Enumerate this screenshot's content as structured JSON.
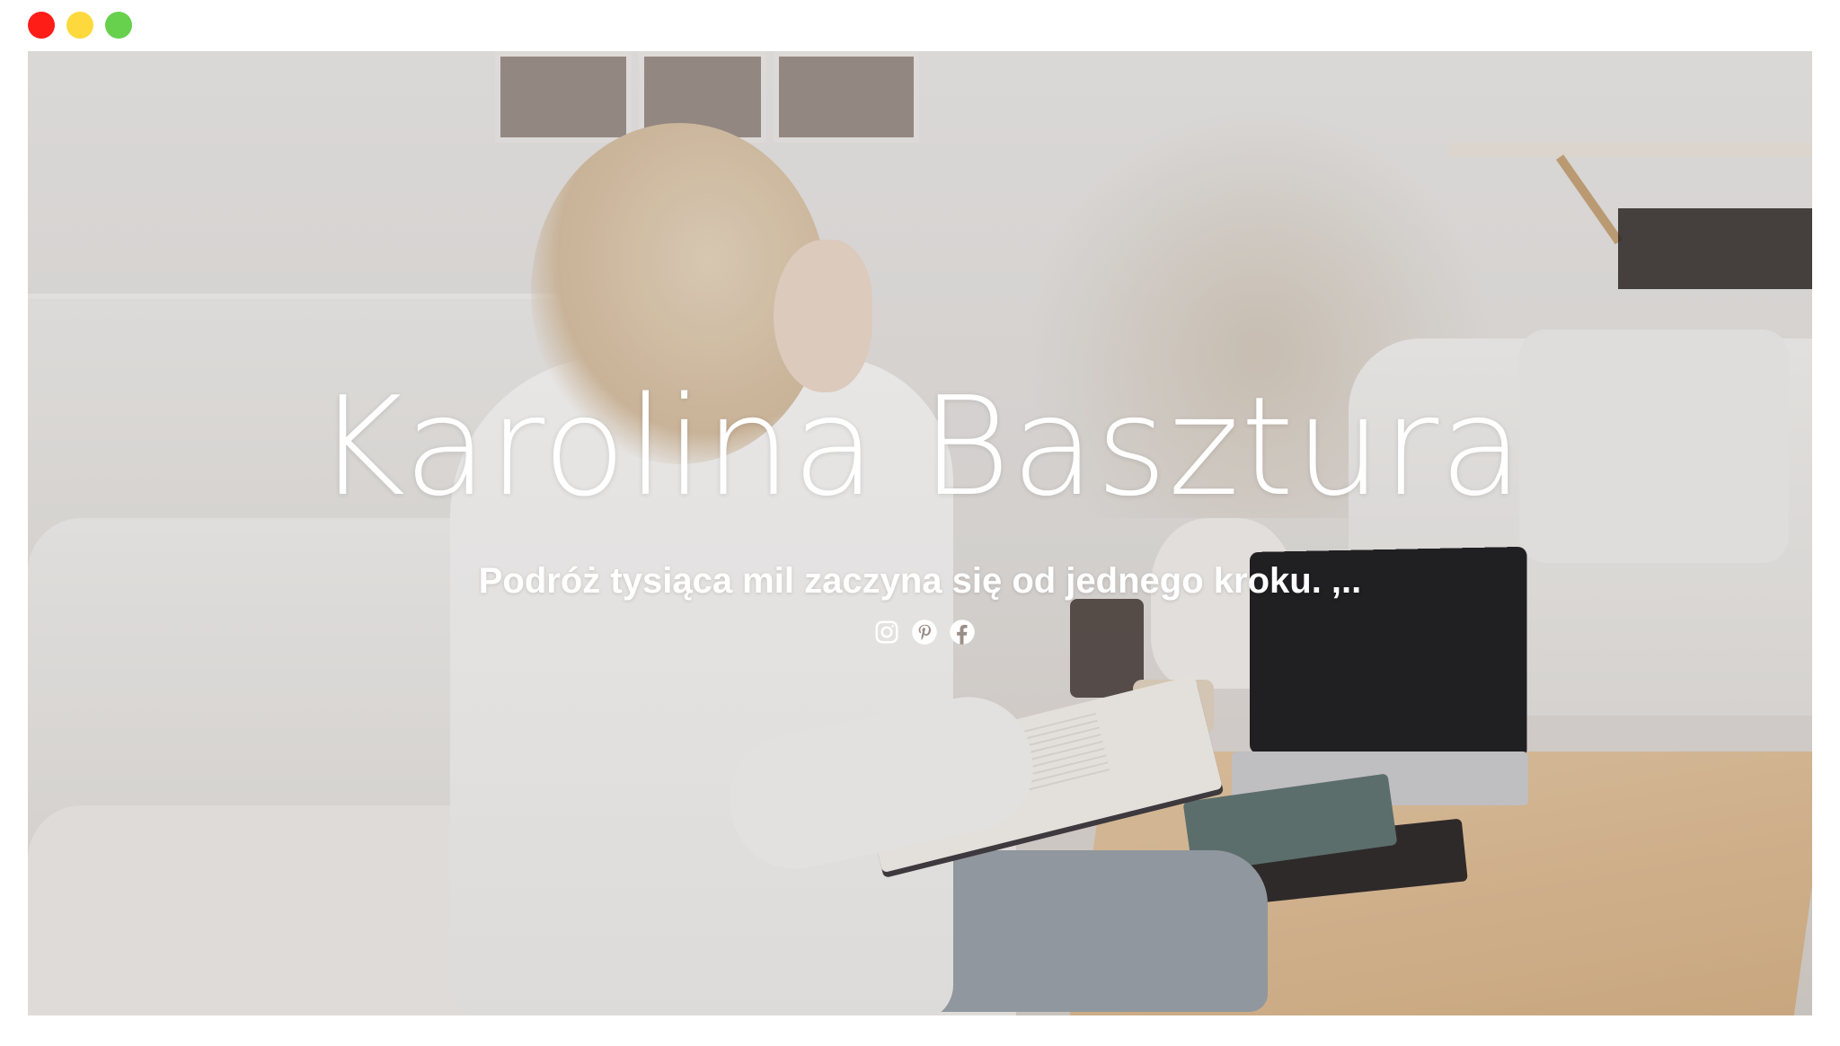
{
  "window": {
    "controls": [
      "close",
      "minimize",
      "maximize"
    ],
    "colors": {
      "close": "#fe1d17",
      "minimize": "#fed93d",
      "maximize": "#67d04d"
    }
  },
  "hero": {
    "title": "Karolina Basztura",
    "tagline": "Podróż tysiąca mil zaczyna się od jednego kroku. ,..",
    "social_links": [
      {
        "icon": "instagram-icon"
      },
      {
        "icon": "pinterest-icon"
      },
      {
        "icon": "facebook-icon"
      }
    ],
    "text_color": "#ffffff"
  }
}
